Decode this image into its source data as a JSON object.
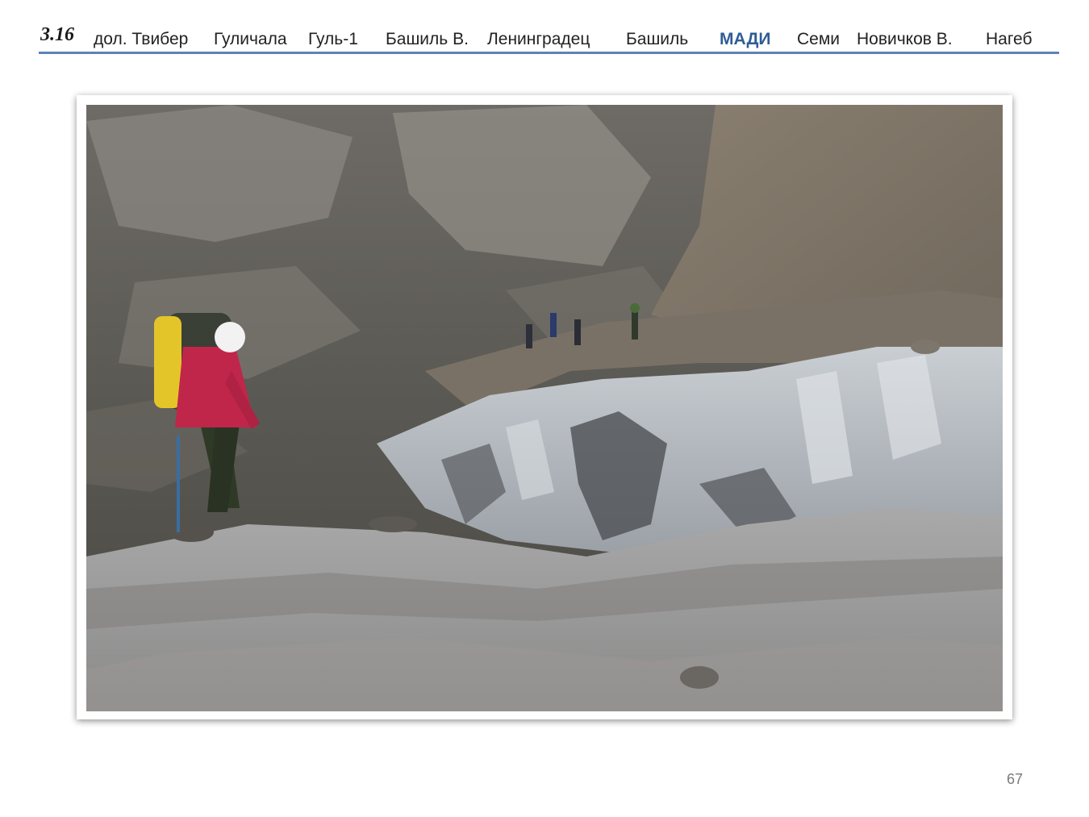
{
  "header": {
    "section_number": "3.16",
    "nav_items": [
      {
        "label": "дол. Твибер",
        "active": false
      },
      {
        "label": "Гуличала",
        "active": false
      },
      {
        "label": "Гуль-1",
        "active": false
      },
      {
        "label": "Башиль В.",
        "active": false
      },
      {
        "label": "Ленинградец",
        "active": false
      },
      {
        "label": "Башиль",
        "active": false
      },
      {
        "label": "МАДИ",
        "active": true
      },
      {
        "label": "Семи",
        "active": false
      },
      {
        "label": "Новичков В.",
        "active": false
      },
      {
        "label": "Нагеб",
        "active": false
      }
    ],
    "accent_color": "#2e5d96",
    "rule_color": "#5b84b8"
  },
  "photo": {
    "subject": "mountaineer-on-glacier"
  },
  "footer": {
    "page_number": "67"
  }
}
